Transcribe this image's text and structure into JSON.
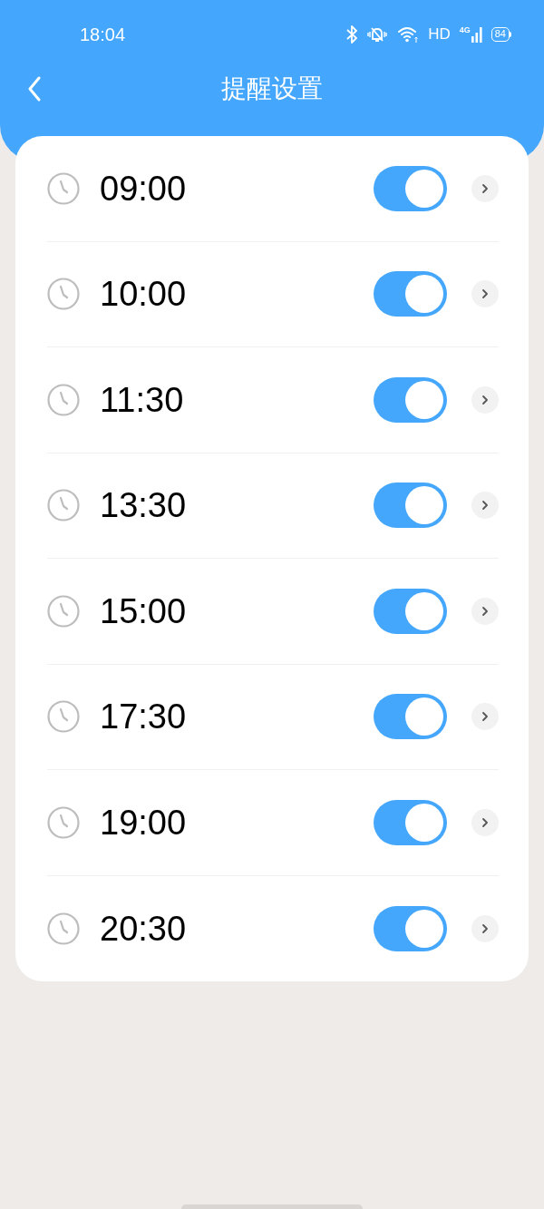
{
  "status_bar": {
    "time": "18:04",
    "network_label": "HD",
    "signal_label": "4G",
    "battery": "84"
  },
  "header": {
    "title": "提醒设置"
  },
  "reminders": [
    {
      "time": "09:00",
      "on": true
    },
    {
      "time": "10:00",
      "on": true
    },
    {
      "time": "11:30",
      "on": true
    },
    {
      "time": "13:30",
      "on": true
    },
    {
      "time": "15:00",
      "on": true
    },
    {
      "time": "17:30",
      "on": true
    },
    {
      "time": "19:00",
      "on": true
    },
    {
      "time": "20:30",
      "on": true
    }
  ]
}
